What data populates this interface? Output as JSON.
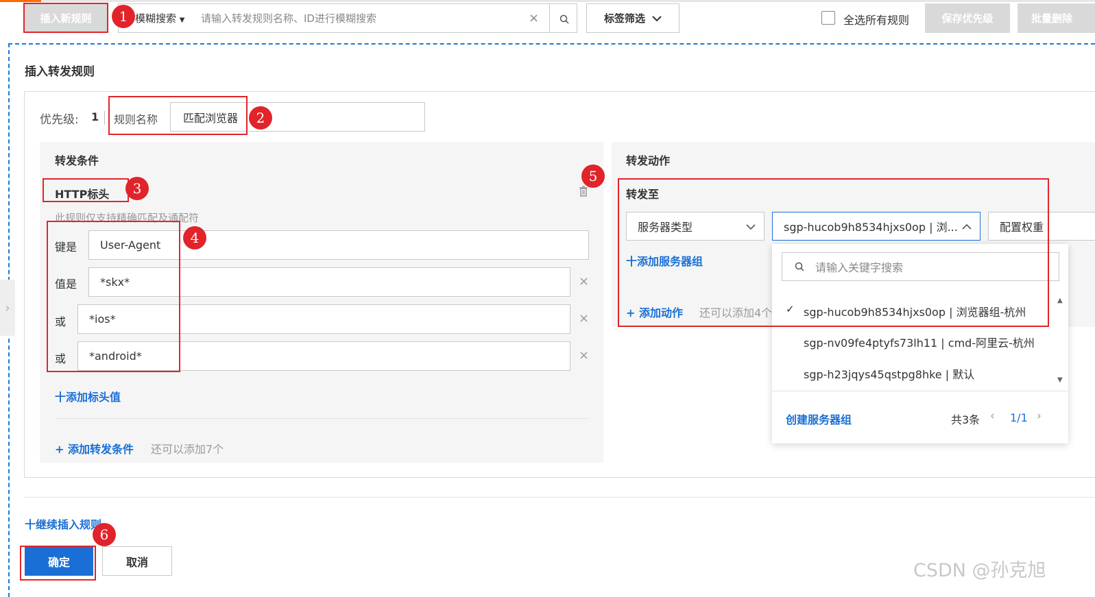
{
  "toolbar": {
    "insert_rule": "插入新规则",
    "search_mode": "模糊搜索",
    "search_placeholder": "请输入转发规则名称、ID进行模糊搜索",
    "tag_filter": "标签筛选",
    "select_all": "全选所有规则",
    "save_priority": "保存优先级",
    "batch_delete": "批量删除"
  },
  "panel": {
    "title": "插入转发规则",
    "priority_label": "优先级:",
    "priority_value": "1",
    "rule_name_label": "规则名称",
    "rule_name_value": "匹配浏览器"
  },
  "conditions": {
    "title": "转发条件",
    "type": "HTTP标头",
    "hint": "此规则仅支持精确匹配及通配符",
    "key_label": "键是",
    "key_value": "User-Agent",
    "value_label": "值是",
    "values": [
      "*skx*",
      "*ios*",
      "*android*"
    ],
    "or_label": "或",
    "add_header_value": "十添加标头值",
    "add_condition": "+ 添加转发条件",
    "remaining": "还可以添加7个"
  },
  "actions": {
    "title": "转发动作",
    "forward_to": "转发至",
    "server_type": "服务器类型",
    "selected_group": "sgp-hucob9h8534hjxs0op | 浏...",
    "config_weight": "配置权重",
    "add_server_group": "十添加服务器组",
    "add_action": "+ 添加动作",
    "remaining": "还可以添加4个"
  },
  "dropdown": {
    "search_placeholder": "请输入关键字搜索",
    "options": [
      "sgp-hucob9h8534hjxs0op | 浏览器组-杭州",
      "sgp-nv09fe4ptyfs73lh11 | cmd-阿里云-杭州",
      "sgp-h23jqys45qstpg8hke | 默认"
    ],
    "create_group": "创建服务器组",
    "total": "共3条",
    "page": "1/1"
  },
  "footer": {
    "continue_insert": "十继续插入规则",
    "confirm": "确定",
    "cancel": "取消"
  },
  "badges": [
    "1",
    "2",
    "3",
    "4",
    "5",
    "6"
  ],
  "watermark": "CSDN @孙克旭",
  "colors": {
    "accent": "#1a6fd6",
    "annotation": "#e0242a",
    "brand": "#ff6a00"
  }
}
